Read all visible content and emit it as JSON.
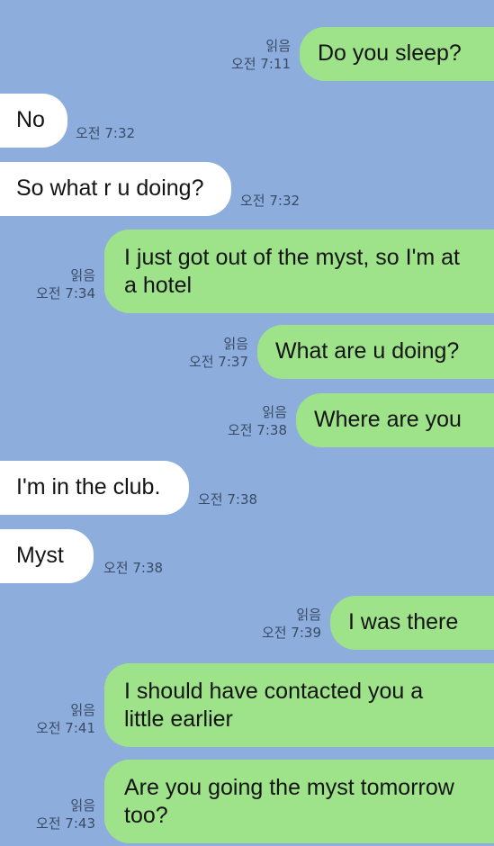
{
  "messages": [
    {
      "dir": "out",
      "text": "Do you sleep?",
      "read": "읽음",
      "time": "오전 7:11"
    },
    {
      "dir": "in",
      "text": "No",
      "time": "오전 7:32"
    },
    {
      "dir": "in",
      "text": "So what r u doing?",
      "time": "오전 7:32"
    },
    {
      "dir": "out",
      "text": "I just got out of the myst, so I'm at a hotel",
      "read": "읽음",
      "time": "오전 7:34"
    },
    {
      "dir": "out",
      "text": "What are u doing?",
      "read": "읽음",
      "time": "오전 7:37"
    },
    {
      "dir": "out",
      "text": "Where are you",
      "read": "읽음",
      "time": "오전 7:38"
    },
    {
      "dir": "in",
      "text": "I'm in the club.",
      "time": "오전 7:38"
    },
    {
      "dir": "in",
      "text": "Myst",
      "time": "오전 7:38"
    },
    {
      "dir": "out",
      "text": "I was there",
      "read": "읽음",
      "time": "오전 7:39"
    },
    {
      "dir": "out",
      "text": "I should have contacted you a little earlier",
      "read": "읽음",
      "time": "오전 7:41"
    },
    {
      "dir": "out",
      "text": "Are you going the myst tomorrow too?",
      "read": "읽음",
      "time": "오전 7:43"
    }
  ],
  "colors": {
    "background": "#8daedc",
    "outgoing_bubble": "#9ee38a",
    "incoming_bubble": "#ffffff"
  }
}
